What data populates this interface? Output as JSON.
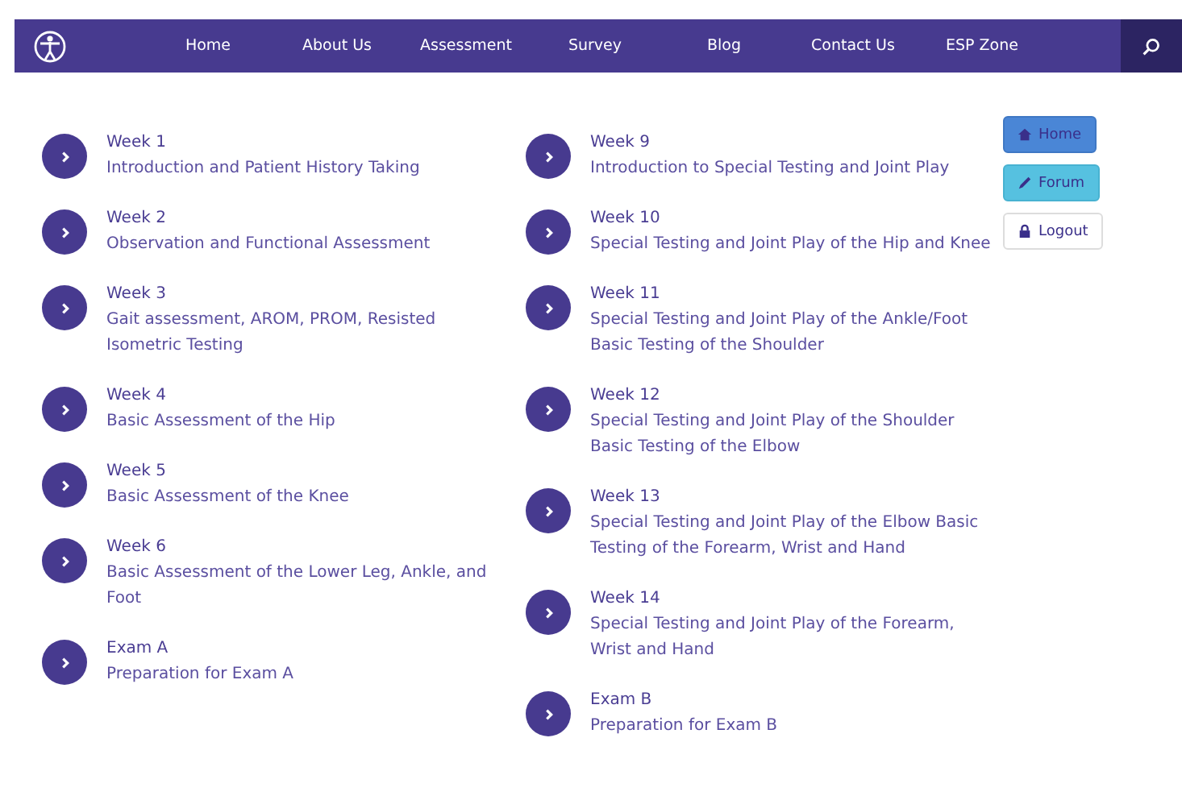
{
  "nav": {
    "items": [
      "Home",
      "About Us",
      "Assessment",
      "Survey",
      "Blog",
      "Contact Us",
      "ESP Zone"
    ]
  },
  "columns": [
    [
      {
        "title": "Week 1",
        "description": "Introduction and Patient History Taking"
      },
      {
        "title": "Week 2",
        "description": "Observation and Functional Assessment"
      },
      {
        "title": "Week 3",
        "description": "Gait assessment, AROM, PROM, Resisted Isometric Testing"
      },
      {
        "title": "Week 4",
        "description": "Basic Assessment of the Hip"
      },
      {
        "title": "Week 5",
        "description": "Basic Assessment of the Knee"
      },
      {
        "title": "Week 6",
        "description": "Basic Assessment of the Lower Leg, Ankle, and Foot"
      },
      {
        "title": "Exam A",
        "description": "Preparation for Exam A"
      }
    ],
    [
      {
        "title": "Week 9",
        "description": "Introduction to Special Testing and Joint Play"
      },
      {
        "title": "Week 10",
        "description": "Special Testing and Joint Play of the Hip and Knee"
      },
      {
        "title": "Week 11",
        "description": "Special Testing and Joint Play of the Ankle/Foot Basic Testing of the Shoulder"
      },
      {
        "title": "Week 12",
        "description": "Special Testing and Joint Play of the Shoulder Basic Testing of the Elbow"
      },
      {
        "title": "Week 13",
        "description": "Special Testing and Joint Play of the Elbow Basic Testing of the Forearm, Wrist and Hand"
      },
      {
        "title": "Week 14",
        "description": "Special Testing and Joint Play of the Forearm, Wrist and Hand"
      },
      {
        "title": "Exam B",
        "description": "Preparation for Exam B"
      }
    ]
  ],
  "side_buttons": [
    {
      "label": "Home",
      "kind": "home"
    },
    {
      "label": "Forum",
      "kind": "forum"
    },
    {
      "label": "Logout",
      "kind": "logout"
    }
  ]
}
